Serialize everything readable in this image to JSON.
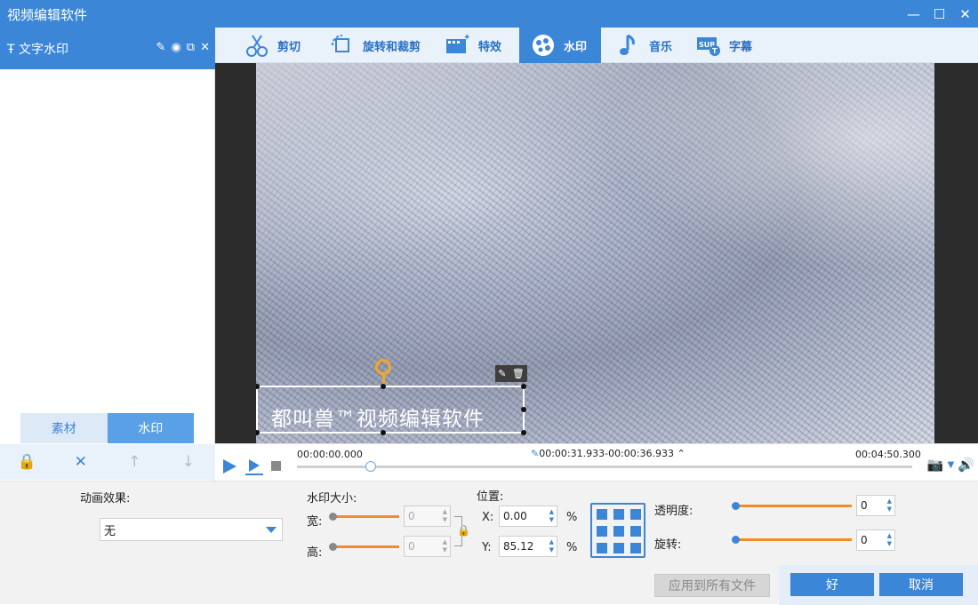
{
  "window": {
    "title": "视频编辑软件",
    "minimize": "—",
    "maximize": "☐",
    "close": "✕"
  },
  "layer": {
    "icon": "Ŧ",
    "label": "文字水印"
  },
  "subtabs": {
    "material": "素材",
    "watermark": "水印"
  },
  "nav": {
    "cut": "剪切",
    "rotate": "旋转和裁剪",
    "effects": "特效",
    "watermark": "水印",
    "music": "音乐",
    "subtitle": "字幕"
  },
  "preview": {
    "watermark_text": "都叫兽™视频编辑软件"
  },
  "timeline": {
    "start": "00:00:00.000",
    "range": "00:00:31.933-00:00:36.933",
    "end": "00:04:50.300",
    "progress": 0.12
  },
  "settings": {
    "animation_label": "动画效果:",
    "animation_value": "无",
    "size_label": "水印大小:",
    "width_label": "宽:",
    "width_value": "0",
    "height_label": "高:",
    "height_value": "0",
    "position_label": "位置:",
    "x_label": "X:",
    "x_value": "0.00",
    "y_label": "Y:",
    "y_value": "85.12",
    "percent": "%",
    "opacity_label": "透明度:",
    "opacity_value": "0",
    "rotation_label": "旋转:",
    "rotation_value": "0"
  },
  "buttons": {
    "apply_all": "应用到所有文件",
    "ok": "好",
    "cancel": "取消"
  },
  "colors": {
    "accent": "#3b86d7",
    "slider": "#f28c28",
    "handle": "#f5a623"
  }
}
